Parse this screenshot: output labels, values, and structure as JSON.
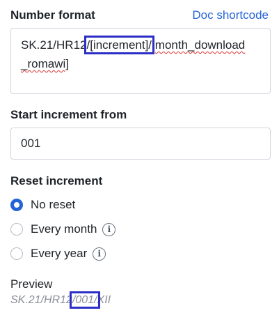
{
  "number_format": {
    "label": "Number format",
    "doc_link": "Doc shortcode",
    "value_prefix": "SK.21/HR12",
    "value_token": "/[increment]/",
    "value_rest_a": "month_download",
    "value_rest_b": "_romawi]"
  },
  "start_increment": {
    "label": "Start increment from",
    "value": "001"
  },
  "reset_increment": {
    "label": "Reset increment",
    "options": [
      {
        "label": "No reset",
        "checked": true,
        "info": false
      },
      {
        "label": "Every month",
        "checked": false,
        "info": true
      },
      {
        "label": "Every year",
        "checked": false,
        "info": true
      }
    ]
  },
  "preview": {
    "label": "Preview",
    "prefix": "SK.21/HR12",
    "token": "/001/",
    "suffix": "XII"
  },
  "colors": {
    "accent": "#2563d9",
    "highlight": "#2c2ec6",
    "muted": "#8b9098"
  },
  "icons": {
    "info": "info-circle-icon"
  }
}
